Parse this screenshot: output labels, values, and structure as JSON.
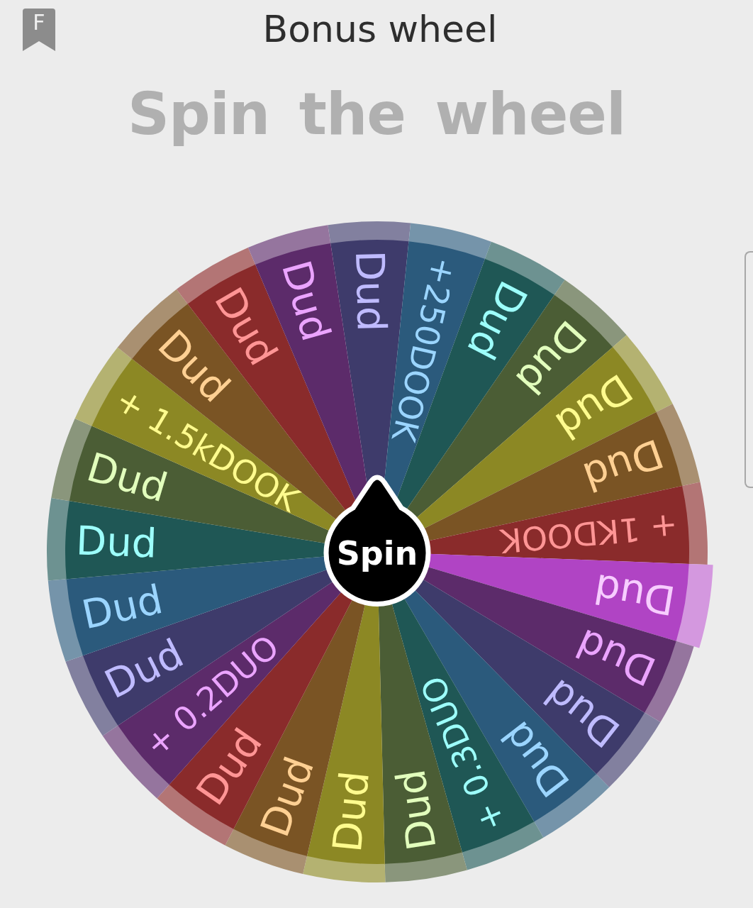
{
  "header": {
    "bookmark_label": "F",
    "title": "Bonus wheel"
  },
  "heading": "Spin the wheel",
  "wheel": {
    "spin_label": "Spin",
    "segments": [
      {
        "label": "Dud",
        "color": "#3e3b6b",
        "selected": false
      },
      {
        "label": "+250DOOK",
        "color": "#2b5a7c",
        "selected": false
      },
      {
        "label": "Dud",
        "color": "#1f5755",
        "selected": false
      },
      {
        "label": "Dud",
        "color": "#4b5d35",
        "selected": false
      },
      {
        "label": "Dud",
        "color": "#8c8824",
        "selected": false
      },
      {
        "label": "Dud",
        "color": "#7a5424",
        "selected": false
      },
      {
        "label": "+ 1KDOOK",
        "color": "#8a2b2b",
        "selected": false
      },
      {
        "label": "Dud",
        "color": "#b044c4",
        "selected": true
      },
      {
        "label": "Dud",
        "color": "#5c2b6a",
        "selected": false
      },
      {
        "label": "Dud",
        "color": "#3e3b6b",
        "selected": false
      },
      {
        "label": "Dud",
        "color": "#2b5a7c",
        "selected": false
      },
      {
        "label": "+ 0.3DUO",
        "color": "#1f5755",
        "selected": false
      },
      {
        "label": "Dud",
        "color": "#4b5d35",
        "selected": false
      },
      {
        "label": "Dud",
        "color": "#8c8824",
        "selected": false
      },
      {
        "label": "Dud",
        "color": "#7a5424",
        "selected": false
      },
      {
        "label": "Dud",
        "color": "#8a2b2b",
        "selected": false
      },
      {
        "label": "+ 0.2DUO",
        "color": "#5c2b6a",
        "selected": false
      },
      {
        "label": "Dud",
        "color": "#3e3b6b",
        "selected": false
      },
      {
        "label": "Dud",
        "color": "#2b5a7c",
        "selected": false
      },
      {
        "label": "Dud",
        "color": "#1f5755",
        "selected": false
      },
      {
        "label": "Dud",
        "color": "#4b5d35",
        "selected": false
      },
      {
        "label": "+ 1.5kDOOK",
        "color": "#8c8824",
        "selected": false
      },
      {
        "label": "Dud",
        "color": "#7a5424",
        "selected": false
      },
      {
        "label": "Dud",
        "color": "#8a2b2b",
        "selected": false
      },
      {
        "label": "Dud",
        "color": "#5c2b6a",
        "selected": false
      }
    ]
  }
}
